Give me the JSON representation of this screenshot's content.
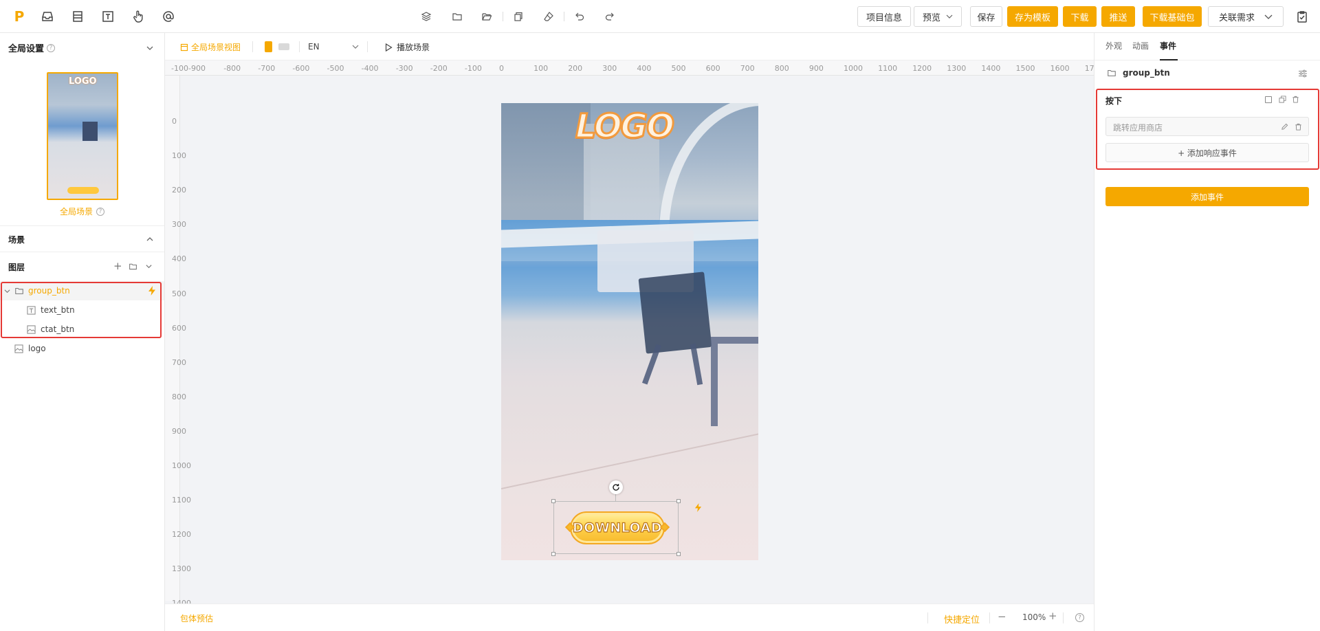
{
  "topbar": {
    "logo_letter": "P",
    "icons": [
      "inbox-icon",
      "layout-icon",
      "text-icon",
      "hand-icon",
      "at-icon"
    ],
    "center_icons": [
      "layers-icon",
      "folder-icon",
      "folder-open-icon",
      "copy-icon",
      "eraser-icon",
      "undo-icon",
      "redo-icon"
    ],
    "project_info": "项目信息",
    "preview": "预览",
    "save": "保存",
    "save_template": "存为模板",
    "download": "下载",
    "push": "推送",
    "download_base": "下载基础包",
    "link_requirement": "关联需求"
  },
  "left": {
    "global_settings": "全局设置",
    "global_scene": "全局场景",
    "scene": "场景",
    "layers": "图层",
    "layer_items": [
      {
        "name": "group_btn",
        "type": "folder"
      },
      {
        "name": "text_btn",
        "type": "text"
      },
      {
        "name": "ctat_btn",
        "type": "image"
      },
      {
        "name": "logo",
        "type": "image"
      }
    ]
  },
  "canvas": {
    "global_view": "全局场景视图",
    "language": "EN",
    "play_scene": "播放场景",
    "h_ticks": [
      "-100",
      "-900",
      "-800",
      "-700",
      "-600",
      "-500",
      "-400",
      "-300",
      "-200",
      "-100",
      "0",
      "100",
      "200",
      "300",
      "400",
      "500",
      "600",
      "700",
      "800",
      "900",
      "1000",
      "1100",
      "1200",
      "1300",
      "1400",
      "1500",
      "1600",
      "17"
    ],
    "v_ticks": [
      "0",
      "100",
      "200",
      "300",
      "400",
      "500",
      "600",
      "700",
      "800",
      "900",
      "1000",
      "1100",
      "1200",
      "1300",
      "1400"
    ],
    "logo_text": "LOGO",
    "button_text": "DOWNLOAD",
    "package_estimate": "包体预估",
    "quick_locate": "快捷定位",
    "zoom": "100%"
  },
  "right": {
    "tabs": [
      "外观",
      "动画",
      "事件"
    ],
    "active_tab": "事件",
    "selected_name": "group_btn",
    "event_title": "按下",
    "event_action": "跳转应用商店",
    "add_response": "+ 添加响应事件",
    "add_event": "添加事件"
  },
  "colors": {
    "accent": "#f5a800",
    "highlight_red": "#e53935"
  }
}
